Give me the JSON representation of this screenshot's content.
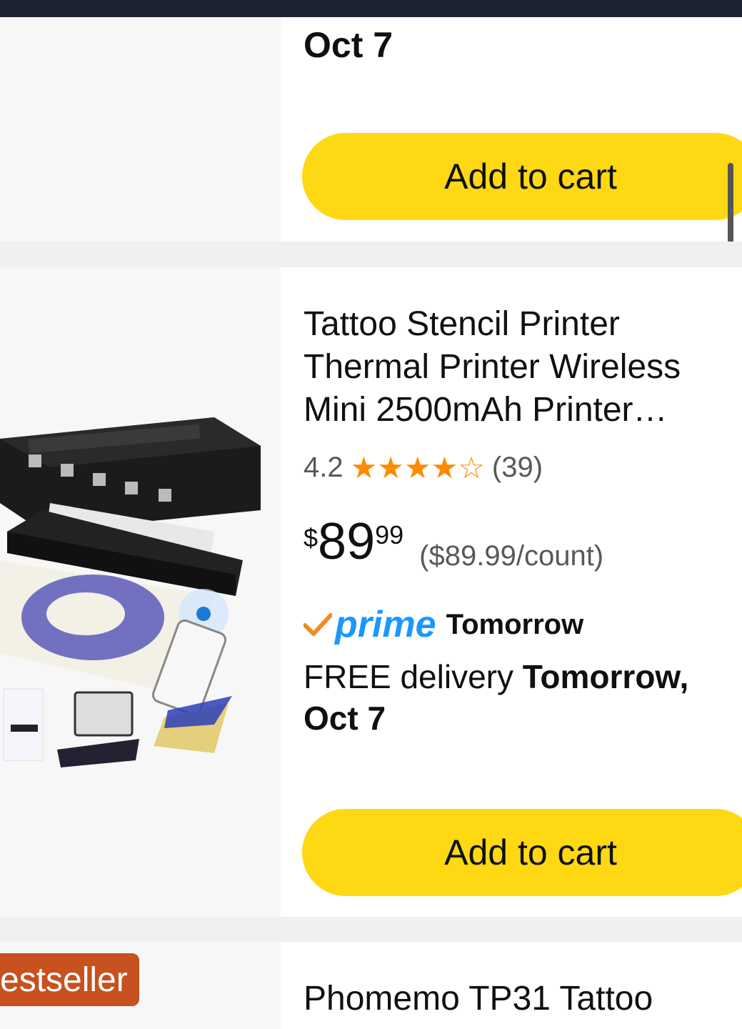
{
  "card_top": {
    "delivery_date": "Oct 7",
    "add_to_cart_label": "Add to cart"
  },
  "product": {
    "title": "Tattoo Stencil Printer Thermal Printer Wireless Mini 2500mAh Printer…",
    "rating": "4.2",
    "rating_value": 4.2,
    "rating_count": "(39)",
    "price_symbol": "$",
    "price_whole": "89",
    "price_fraction": "99",
    "unit_price": "($89.99/count)",
    "prime_label": "prime",
    "prime_eta": "Tomorrow",
    "delivery_prefix": "FREE delivery",
    "delivery_date": "Tomorrow, Oct 7",
    "add_to_cart_label": "Add to cart",
    "image_icon": "tattoo-stencil-printer-image",
    "colors": {
      "star": "#ff8a00",
      "prime": "#1a98ff",
      "check": "#f08a24",
      "button": "#ffd814"
    }
  },
  "next_product": {
    "badge": "estseller",
    "title": "Phomemo TP31 Tattoo",
    "badge_color": "#c7511f"
  }
}
